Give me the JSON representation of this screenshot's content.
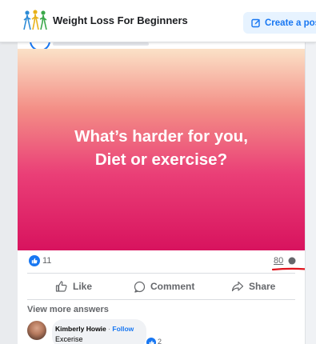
{
  "header": {
    "group_name": "Weight Loss For Beginners",
    "create_post_label": "Create a pos",
    "logo_icon": "group-logo-icon"
  },
  "post": {
    "image_text_line1": "What’s harder for you,",
    "image_text_line2": "Diet or exercise?",
    "image_gradient": [
      "#fbe1c7",
      "#f38e86",
      "#ea3f77",
      "#d8135e"
    ],
    "like_count": "11",
    "comment_count": "80"
  },
  "actions": {
    "like_label": "Like",
    "comment_label": "Comment",
    "share_label": "Share"
  },
  "comments": {
    "view_more_label": "View more answers",
    "items": [
      {
        "name": "Kimberly Howie",
        "separator": "·",
        "follow_label": "Follow",
        "text": "Excerise",
        "reaction_count": "2"
      }
    ]
  },
  "colors": {
    "accent": "#1877f2",
    "annotation": "#e0141e"
  }
}
